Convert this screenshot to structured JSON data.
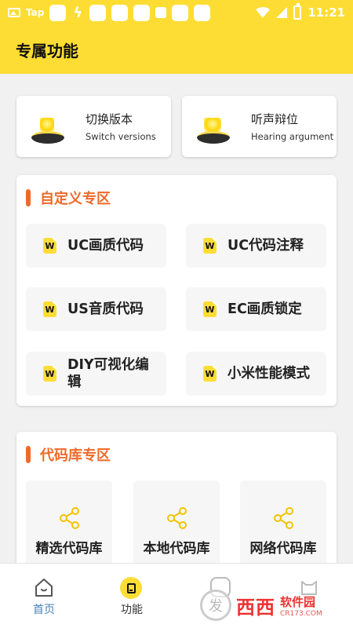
{
  "status_bar": {
    "app_text": "Tap",
    "time": "11:21"
  },
  "header": {
    "title": "专属功能"
  },
  "top_cards": [
    {
      "title": "切换版本",
      "subtitle": "Switch versions"
    },
    {
      "title": "听声辩位",
      "subtitle": "Hearing argument"
    }
  ],
  "custom_section": {
    "title": "自定义专区",
    "items": [
      {
        "icon_text": "W",
        "label": "UC画质代码"
      },
      {
        "icon_text": "W",
        "label": "UC代码注释"
      },
      {
        "icon_text": "W",
        "label": "US音质代码"
      },
      {
        "icon_text": "W",
        "label": "EC画质锁定"
      },
      {
        "icon_text": "W",
        "label": "DIY可视化编辑"
      },
      {
        "icon_text": "W",
        "label": "小米性能模式"
      }
    ]
  },
  "library_section": {
    "title": "代码库专区",
    "items": [
      {
        "label": "精选代码库"
      },
      {
        "label": "本地代码库"
      },
      {
        "label": "网络代码库"
      }
    ]
  },
  "tab_bar": {
    "tabs": [
      {
        "label": "首页",
        "active": false
      },
      {
        "label": "功能",
        "active": true
      }
    ]
  },
  "watermark": {
    "circle": "发",
    "title": "西西",
    "sub1": "软件园",
    "sub2": "CR173.COM"
  },
  "colors": {
    "brand_yellow": "#fddd34",
    "accent_orange": "#ef6a2a",
    "inactive_tab": "#4a82b4"
  }
}
